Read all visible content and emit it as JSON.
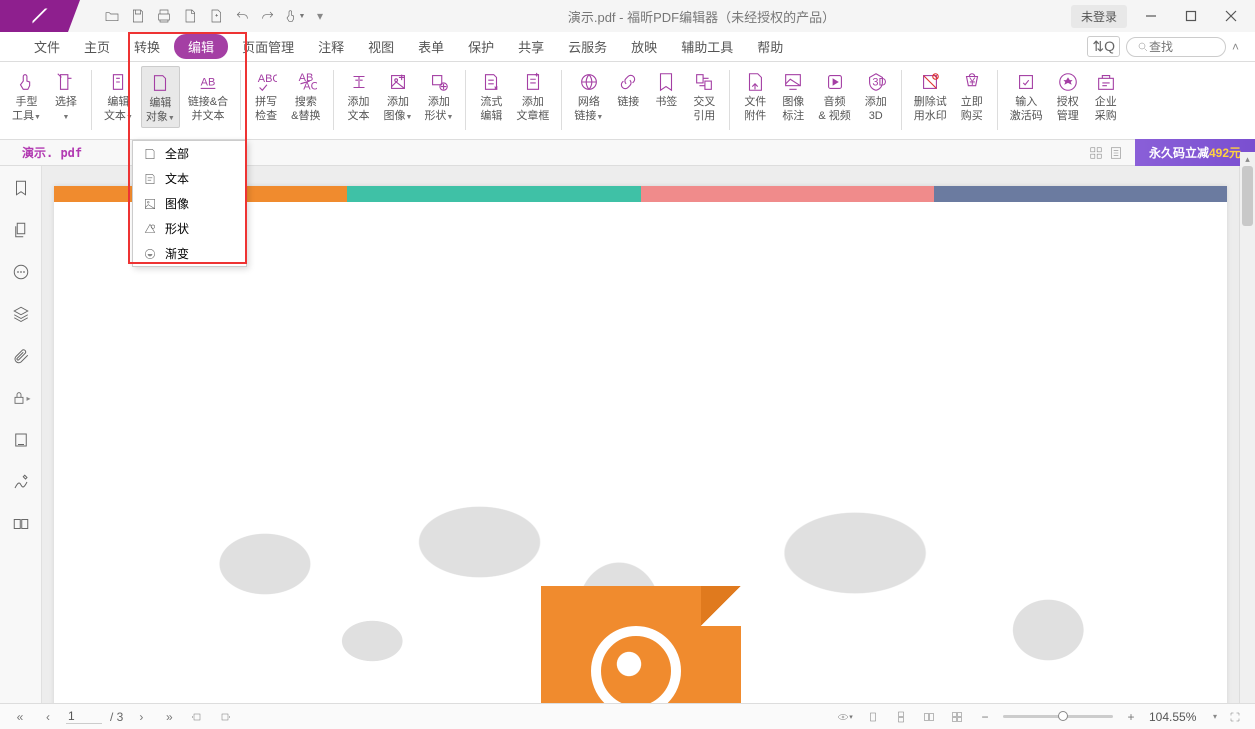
{
  "title": "演示.pdf - 福昕PDF编辑器（未经授权的产品）",
  "auth": {
    "login": "未登录"
  },
  "menu": {
    "file": "文件",
    "home": "主页",
    "convert": "转换",
    "edit": "编辑",
    "page_manage": "页面管理",
    "annotate": "注释",
    "view": "视图",
    "form": "表单",
    "protect": "保护",
    "share": "共享",
    "cloud": "云服务",
    "slideshow": "放映",
    "accessibility": "辅助工具",
    "help": "帮助"
  },
  "search": {
    "placeholder": "查找"
  },
  "ribbon": [
    {
      "l1": "手型",
      "l2": "工具",
      "drop": true
    },
    {
      "l1": "选择",
      "l2": "",
      "drop": true
    },
    {
      "l1": "编辑",
      "l2": "文本",
      "drop": true
    },
    {
      "l1": "编辑",
      "l2": "对象",
      "drop": true
    },
    {
      "l1": "链接&合",
      "l2": "并文本"
    },
    {
      "l1": "拼写",
      "l2": "检查"
    },
    {
      "l1": "搜索",
      "l2": "&替换"
    },
    {
      "l1": "添加",
      "l2": "文本"
    },
    {
      "l1": "添加",
      "l2": "图像",
      "drop": true
    },
    {
      "l1": "添加",
      "l2": "形状",
      "drop": true
    },
    {
      "l1": "流式",
      "l2": "编辑"
    },
    {
      "l1": "添加",
      "l2": "文章框"
    },
    {
      "l1": "网络",
      "l2": "链接",
      "drop": true
    },
    {
      "l1": "链接",
      "l2": ""
    },
    {
      "l1": "书签",
      "l2": ""
    },
    {
      "l1": "交叉",
      "l2": "引用"
    },
    {
      "l1": "文件",
      "l2": "附件"
    },
    {
      "l1": "图像",
      "l2": "标注"
    },
    {
      "l1": "音频",
      "l2": "& 视频"
    },
    {
      "l1": "添加",
      "l2": "3D"
    },
    {
      "l1": "删除试",
      "l2": "用水印"
    },
    {
      "l1": "立即",
      "l2": "购买"
    },
    {
      "l1": "输入",
      "l2": "激活码"
    },
    {
      "l1": "授权",
      "l2": "管理"
    },
    {
      "l1": "企业",
      "l2": "采购"
    }
  ],
  "dropdown": [
    "全部",
    "文本",
    "图像",
    "形状",
    "渐变"
  ],
  "doc_tab": "演示. pdf",
  "promo": {
    "text": "永久码立减",
    "amount": "492元"
  },
  "status": {
    "page_input": "1",
    "page_total": "/ 3",
    "zoom_pct": "104.55%"
  }
}
